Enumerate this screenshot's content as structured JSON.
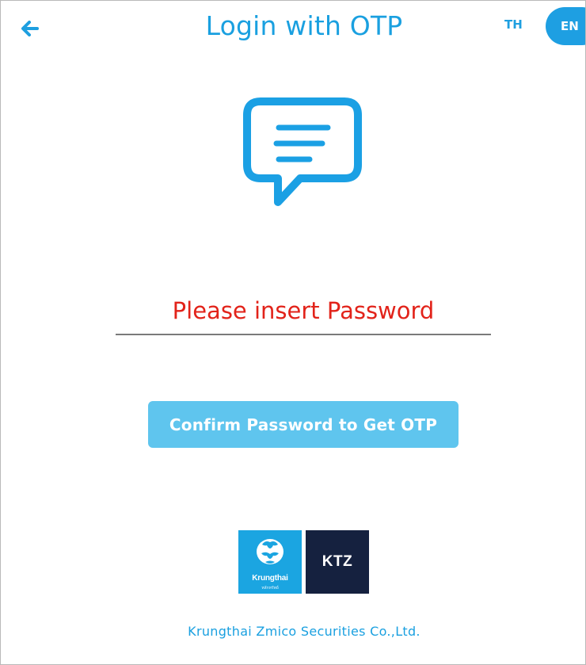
{
  "header": {
    "back_icon": "arrow-left-icon",
    "title": "Login with OTP",
    "lang_th": "TH",
    "lang_en": "EN",
    "active_lang": "EN"
  },
  "main": {
    "message_icon": "chat-bubble-icon",
    "password": {
      "value": "",
      "placeholder": "Please insert Password"
    },
    "confirm_button": "Confirm Password to Get OTP"
  },
  "footer": {
    "logo_krungthai_text": "Krungthai",
    "logo_krungthai_sub": "หลักทรัพย์",
    "logo_ktz_text": "KTZ",
    "company_name": "Krungthai Zmico Securities Co.,Ltd."
  },
  "colors": {
    "primary": "#1aa0e0",
    "button": "#5fc5ee",
    "placeholder": "#e2231a",
    "ktz_navy": "#15213f"
  }
}
